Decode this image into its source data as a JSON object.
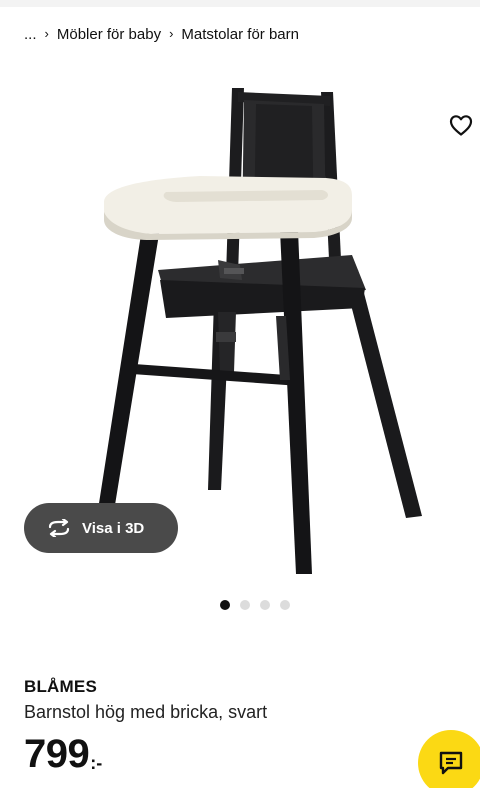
{
  "breadcrumb": {
    "ellipsis": "...",
    "items": [
      {
        "label": "Möbler för baby"
      },
      {
        "label": "Matstolar för barn"
      }
    ]
  },
  "gallery": {
    "view_3d_label": "Visa i 3D",
    "dot_count": 4,
    "active_index": 0
  },
  "product": {
    "name": "BLÅMES",
    "description": "Barnstol hög med bricka, svart",
    "price_integer": "799",
    "price_suffix": ":-"
  },
  "icons": {
    "favorite": "heart-outline-icon",
    "view_3d": "rotate-icon",
    "chat": "chat-bubble-icon",
    "separator": "chevron-right-icon"
  },
  "colors": {
    "chat_button": "#fbd914",
    "view_3d_button": "#4a4a4a",
    "chair_body": "#1c1c1e",
    "tray": "#f2efe6"
  }
}
